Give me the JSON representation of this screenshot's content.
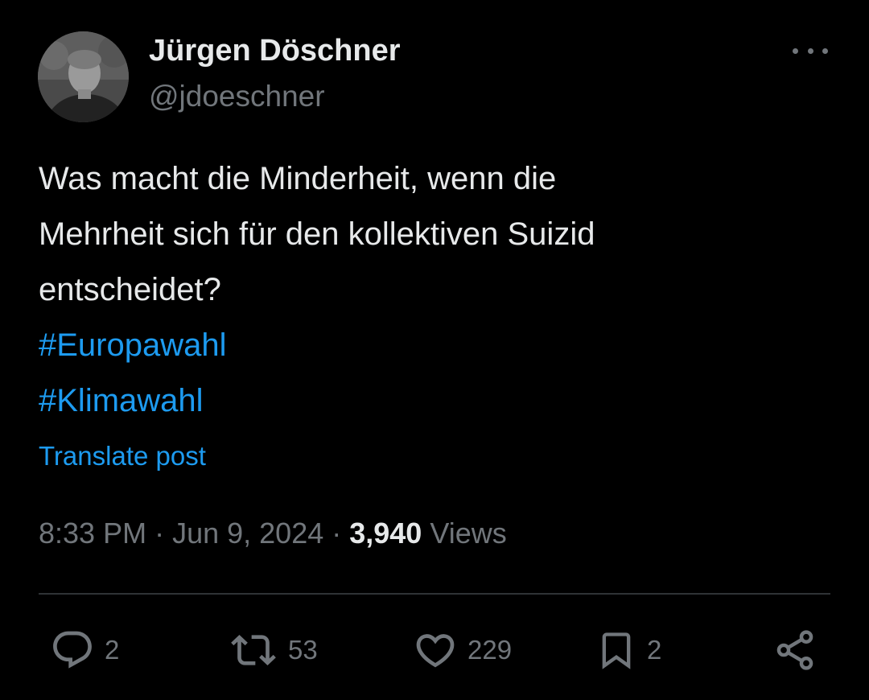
{
  "author": {
    "display_name": "Jürgen Döschner",
    "handle": "@jdoeschner"
  },
  "post": {
    "text_lines": [
      "Was macht die Minderheit, wenn die",
      "Mehrheit sich für den kollektiven Suizid",
      "entscheidet?"
    ],
    "hashtags": [
      "#Europawahl",
      "#Klimawahl"
    ],
    "translate_label": "Translate post"
  },
  "meta": {
    "time": "8:33 PM",
    "separator": " · ",
    "date": "Jun 9, 2024",
    "views_count": "3,940",
    "views_label": " Views"
  },
  "actions": {
    "replies": "2",
    "reposts": "53",
    "likes": "229",
    "bookmarks": "2"
  },
  "icons": {
    "more": "more-horizontal-icon",
    "reply": "reply-icon",
    "repost": "repost-icon",
    "like": "heart-icon",
    "bookmark": "bookmark-icon",
    "share": "share-icon"
  },
  "colors": {
    "background": "#000000",
    "primary_text": "#e7e9ea",
    "secondary_text": "#71767b",
    "accent": "#1d9bf0",
    "divider": "#2f3336"
  }
}
